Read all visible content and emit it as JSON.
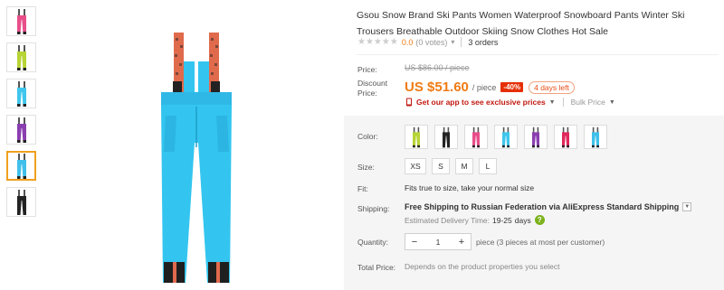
{
  "product": {
    "title": "Gsou Snow Brand Ski Pants Women Waterproof Snowboard Pants Winter Ski Trousers Breathable Outdoor Skiing Snow Clothes Hot Sale",
    "rating_stars": "★★★★★",
    "rating_score": "0.0",
    "rating_votes": "(0 votes)",
    "rating_chevron": "▾",
    "orders": "3 orders"
  },
  "thumbnails": [
    {
      "color": "#e84f8a",
      "active": false
    },
    {
      "color": "#b6d435",
      "active": false
    },
    {
      "color": "#3fc6ec",
      "active": false
    },
    {
      "color": "#8a3fb0",
      "active": false
    },
    {
      "color": "#3fc0ea",
      "active": true
    },
    {
      "color": "#232323",
      "active": false
    }
  ],
  "main_image": {
    "pant_color": "#33c5ef",
    "suspender_color": "#e06a4c"
  },
  "labels": {
    "price": "Price:",
    "discount_price": "Discount Price:",
    "color": "Color:",
    "size": "Size:",
    "fit": "Fit:",
    "shipping": "Shipping:",
    "quantity": "Quantity:",
    "total_price": "Total Price:"
  },
  "pricing": {
    "old_price": "US $86.00 / piece",
    "price": "US $51.60",
    "per": "/ piece",
    "discount": "-40%",
    "days_left": "4 days left",
    "app_promo": "Get our app to see exclusive prices",
    "bulk_price": "Bulk Price"
  },
  "colors": [
    "#b6d435",
    "#232323",
    "#e84f8a",
    "#3fc6ec",
    "#8a3fb0",
    "#e0285a",
    "#3fc0ea"
  ],
  "sizes": [
    "XS",
    "S",
    "M",
    "L"
  ],
  "fit_text": "Fits true to size, take your normal size",
  "shipping": {
    "text": "Free Shipping to Russian Federation via AliExpress Standard Shipping",
    "estimated_label": "Estimated Delivery Time:",
    "estimated_days": "19-25",
    "days_word": "days"
  },
  "quantity": {
    "value": "1",
    "minus": "−",
    "plus": "+",
    "note": "piece (3 pieces at most per customer)"
  },
  "total_text": "Depends on the product properties you select",
  "accent_color": "#f07b13"
}
